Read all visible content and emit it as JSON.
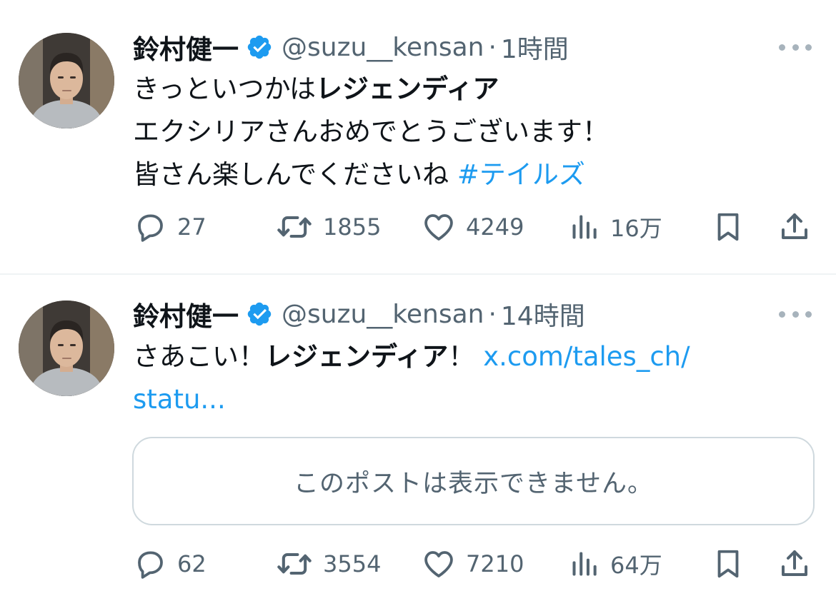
{
  "tweets": [
    {
      "author_name": "鈴村健一",
      "handle": "@suzu__kensan",
      "separator": "·",
      "time": "1時間",
      "text": {
        "line1_normal": "きっといつかは",
        "line1_bold": "レジェンディア",
        "line2": "エクシリアさんおめでとうございます！",
        "line3_normal": "皆さん楽しんでくださいね ",
        "line3_hashtag": "#テイルズ"
      },
      "counts": {
        "replies": "27",
        "retweets": "1855",
        "likes": "4249",
        "views": "16万"
      }
    },
    {
      "author_name": "鈴村健一",
      "handle": "@suzu__kensan",
      "separator": "·",
      "time": "14時間",
      "text": {
        "line1_normal": "さあこい！",
        "line1_bold": "レジェンディア",
        "line1_after": "！ ",
        "line1_link": "x.com/tales_ch/",
        "line2_link": "statu..."
      },
      "quote_unavailable": "このポストは表示できません。",
      "counts": {
        "replies": "62",
        "retweets": "3554",
        "likes": "7210",
        "views": "64万"
      }
    }
  ],
  "icons": [
    "avatar",
    "verified-badge-icon",
    "more-icon",
    "reply-icon",
    "retweet-icon",
    "like-icon",
    "views-icon",
    "bookmark-icon",
    "share-icon"
  ],
  "colors": {
    "text": "#0f1419",
    "secondary": "#536471",
    "link": "#1d9bf0",
    "verified": "#1d9bf0",
    "border": "#cfd9de"
  }
}
